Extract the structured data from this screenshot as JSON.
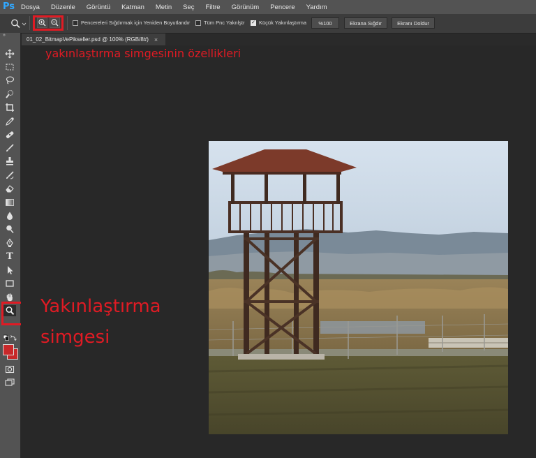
{
  "app": {
    "logo": "Ps"
  },
  "menu": [
    "Dosya",
    "Düzenle",
    "Görüntü",
    "Katman",
    "Metin",
    "Seç",
    "Filtre",
    "Görünüm",
    "Pencere",
    "Yardım"
  ],
  "options_bar": {
    "resize_windows": {
      "label": "Pencereleri Sığdırmak için Yeniden Boyutlandır",
      "checked": false
    },
    "zoom_all_windows": {
      "label": "Tüm Pnc Yaknlştr",
      "checked": false
    },
    "scrubby_zoom": {
      "label": "Küçük Yakınlaştırma",
      "checked": true
    },
    "zoom_100": "%100",
    "fit_screen": "Ekrana Sığdır",
    "fill_screen": "Ekranı Doldur"
  },
  "document": {
    "tab_title": "01_02_BitmapVePikseller.psd @ 100% (RGB/8#)",
    "close_glyph": "×"
  },
  "annotations": {
    "zoom_properties": "yakınlaştırma simgesinin özellikleri",
    "zoom_tool_line1": "Yakınlaştırma",
    "zoom_tool_line2": "simgesi",
    "color": "#e01b24"
  },
  "colors": {
    "menubar": "#535353",
    "options_bar": "#3c3c3c",
    "canvas_bg": "#282828",
    "foreground_color": "#c8282a",
    "background_color": "#c8282a"
  },
  "toolbar": {
    "collapse_glyph": "»",
    "tools": [
      "move-tool",
      "marquee-tool",
      "lasso-tool",
      "quick-selection-tool",
      "crop-tool",
      "eyedropper-tool",
      "healing-brush-tool",
      "brush-tool",
      "clone-stamp-tool",
      "history-brush-tool",
      "eraser-tool",
      "gradient-tool",
      "blur-tool",
      "dodge-tool",
      "pen-tool",
      "type-tool",
      "path-selection-tool",
      "rectangle-tool",
      "hand-tool",
      "zoom-tool"
    ],
    "text_tool_glyph": "T"
  }
}
